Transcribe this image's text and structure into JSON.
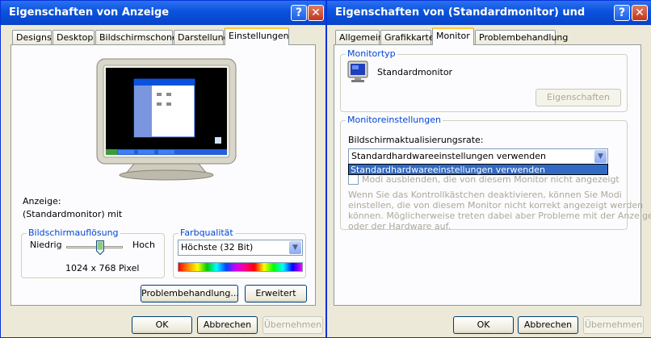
{
  "left_window": {
    "title": "Eigenschaften von Anzeige",
    "tabs": [
      "Designs",
      "Desktop",
      "Bildschirmschoner",
      "Darstellung",
      "Einstellungen"
    ],
    "active_tab": "Einstellungen",
    "display_label": "Anzeige:",
    "display_value": "(Standardmonitor) mit",
    "resolution": {
      "legend": "Bildschirmauflösung",
      "low": "Niedrig",
      "high": "Hoch",
      "value": "1024 x 768 Pixel",
      "slider_fraction": 0.6
    },
    "color_quality": {
      "legend": "Farbqualität",
      "selected": "Höchste (32 Bit)"
    },
    "troubleshoot_button": "Problembehandlung...",
    "advanced_button": "Erweitert",
    "ok_button": "OK",
    "cancel_button": "Abbrechen",
    "apply_button": "Übernehmen"
  },
  "right_window": {
    "title": "Eigenschaften von (Standardmonitor) und",
    "tabs": [
      "Allgemein",
      "Grafikkarte",
      "Monitor",
      "Problembehandlung"
    ],
    "active_tab": "Monitor",
    "monitor_type": {
      "legend": "Monitortyp",
      "name": "Standardmonitor",
      "properties_button": "Eigenschaften"
    },
    "monitor_settings": {
      "legend": "Monitoreinstellungen",
      "refresh_label": "Bildschirmaktualisierungsrate:",
      "selected": "Standardhardwareeinstellungen verwenden",
      "dropdown_option": "Standardhardwareeinstellungen verwenden",
      "hide_modes_label": "Modi ausblenden, die von diesem Monitor nicht angezeigt werden",
      "description": [
        "Wenn Sie das Kontrollkästchen deaktivieren, können Sie Modi",
        "einstellen, die von diesem Monitor nicht korrekt angezeigt werden",
        "können. Möglicherweise treten dabei aber Probleme mit der Anzeige",
        "oder der Hardware auf."
      ]
    },
    "ok_button": "OK",
    "cancel_button": "Abbrechen",
    "apply_button": "Übernehmen"
  },
  "icons": {
    "help": "?",
    "close": "✕",
    "dropdown": "▼"
  },
  "colors": {
    "titlebar": "#0a52dd",
    "active_tab_highlight": "#ffc83c",
    "group_legend": "#0046d5",
    "selection": "#316ac5"
  }
}
